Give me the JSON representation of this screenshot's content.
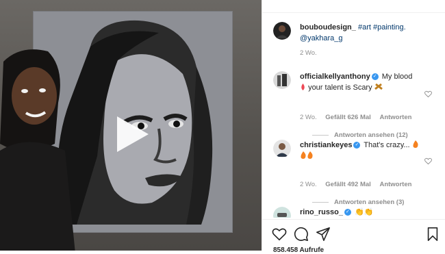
{
  "post": {
    "author": "bouboudesign_",
    "caption_tags": "#art #painting.",
    "caption_mention": "@yakhara_g",
    "time": "2 Wo."
  },
  "comments": [
    {
      "user": "officialkellyanthony",
      "verified": true,
      "text_a": "My blood",
      "text_b": "your talent is Scary",
      "time": "2 Wo.",
      "likes": "Gefällt 626 Mal",
      "reply": "Antworten",
      "view_replies": "Antworten ansehen (12)"
    },
    {
      "user": "christiankeyes",
      "verified": true,
      "text": "That's crazy...",
      "time": "2 Wo.",
      "likes": "Gefällt 492 Mal",
      "reply": "Antworten",
      "view_replies": "Antworten ansehen (3)"
    },
    {
      "user": "rino_russo_",
      "verified": true,
      "text": "👏👏"
    }
  ],
  "actions": {
    "like_icon": "heart-icon",
    "comment_icon": "comment-icon",
    "share_icon": "share-icon",
    "save_icon": "bookmark-icon"
  },
  "views": "858.458 Aufrufe",
  "colors": {
    "accent": "#3897f0",
    "link": "#00376b",
    "muted": "#8e8e8e",
    "heart_red": "#ed4956",
    "fire": "#f58220"
  }
}
